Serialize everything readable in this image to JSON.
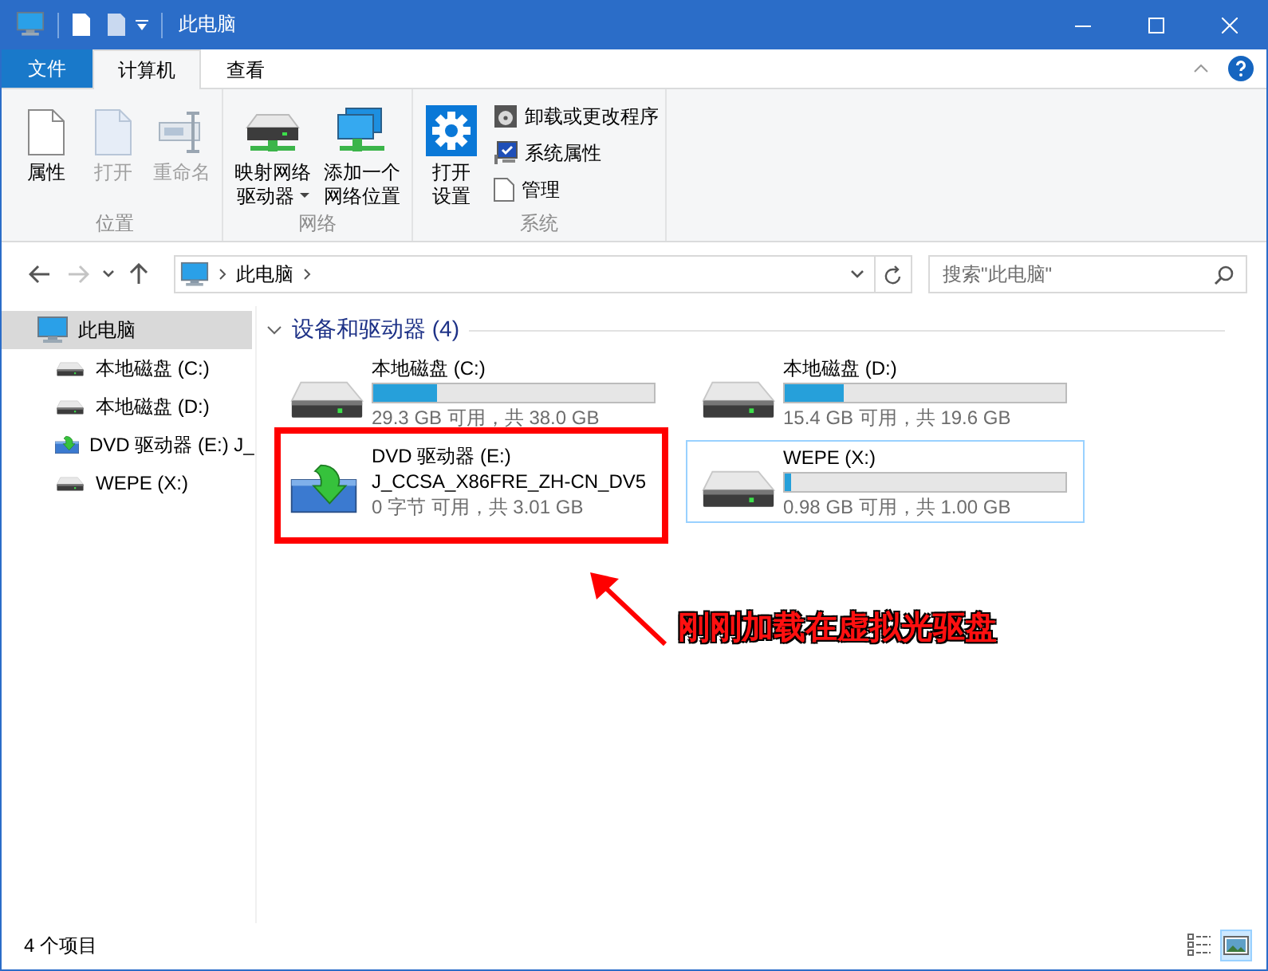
{
  "window": {
    "title": "此电脑"
  },
  "ribbon": {
    "file_tab": "文件",
    "tabs": [
      {
        "label": "计算机",
        "selected": true
      },
      {
        "label": "查看",
        "selected": false
      }
    ],
    "groups": [
      {
        "label": "位置",
        "buttons": [
          {
            "lines": [
              "属性"
            ],
            "disabled": false
          },
          {
            "lines": [
              "打开"
            ],
            "disabled": true
          },
          {
            "lines": [
              "重命名"
            ],
            "disabled": true
          }
        ]
      },
      {
        "label": "网络",
        "buttons": [
          {
            "lines": [
              "映射网络",
              "驱动器"
            ],
            "disabled": false,
            "dropdown": true
          },
          {
            "lines": [
              "添加一个",
              "网络位置"
            ],
            "disabled": false
          }
        ]
      },
      {
        "label": "系统",
        "buttons": [
          {
            "lines": [
              "打开",
              "设置"
            ],
            "disabled": false
          }
        ],
        "small_buttons": [
          {
            "label": "卸载或更改程序"
          },
          {
            "label": "系统属性"
          },
          {
            "label": "管理"
          }
        ]
      }
    ]
  },
  "nav_buttons": [
    {
      "kind": "back",
      "disabled": false
    },
    {
      "kind": "forward",
      "disabled": true
    },
    {
      "kind": "recent",
      "disabled": false
    },
    {
      "kind": "up",
      "disabled": false
    }
  ],
  "address": {
    "path": "此电脑"
  },
  "search": {
    "placeholder": "搜索\"此电脑\""
  },
  "sidebar": {
    "items": [
      {
        "label": "此电脑",
        "kind": "computer",
        "selected": true,
        "children": [
          {
            "label": "本地磁盘 (C:)",
            "kind": "disk",
            "selected": false
          },
          {
            "label": "本地磁盘 (D:)",
            "kind": "disk",
            "selected": false
          },
          {
            "label": "DVD 驱动器 (E:) J_",
            "kind": "dvd",
            "selected": false
          },
          {
            "label": "WEPE (X:)",
            "kind": "disk",
            "selected": false
          }
        ]
      }
    ]
  },
  "section": {
    "title": "设备和驱动器 (4)",
    "expanded": true
  },
  "drives": [
    {
      "kind": "disk",
      "name": "本地磁盘 (C:)",
      "level": 0.23,
      "reading": "29.3 GB 可用，共 38.0 GB",
      "selected": false
    },
    {
      "kind": "disk",
      "name": "本地磁盘 (D:)",
      "level": 0.21,
      "reading": "15.4 GB 可用，共 19.6 GB",
      "selected": false
    },
    {
      "kind": "dvd",
      "name": "DVD 驱动器 (E:)",
      "label": "J_CCSA_X86FRE_ZH-CN_DV5",
      "reading": "0 字节 可用，共 3.01 GB",
      "selected": false
    },
    {
      "kind": "disk",
      "name": "WEPE (X:)",
      "level": 0.02,
      "reading": "0.98 GB 可用，共 1.00 GB",
      "selected": true
    }
  ],
  "annotation": {
    "text": "刚刚加载在虚拟光驱盘"
  },
  "status_bar": {
    "count": "4 个项目",
    "views": [
      {
        "kind": "details",
        "selected": false
      },
      {
        "kind": "tiles",
        "selected": true
      }
    ]
  }
}
